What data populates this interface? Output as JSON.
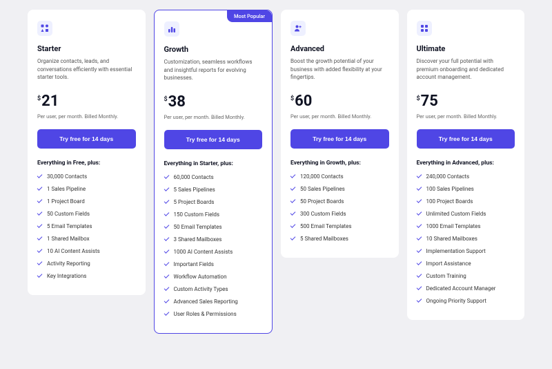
{
  "plans": [
    {
      "name": "Starter",
      "description": "Organize contacts, leads, and conversations efficiently with essential starter tools.",
      "currency": "$",
      "price": "21",
      "billing": "Per user, per month. Billed Monthly.",
      "cta": "Try free for 14 days",
      "features_heading": "Everything in Free, plus:",
      "features": [
        "30,000 Contacts",
        "1 Sales Pipeline",
        "1 Project Board",
        "50 Custom Fields",
        "5 Email Templates",
        "1 Shared Mailbox",
        "10 AI Content Assists",
        "Activity Reporting",
        "Key Integrations"
      ],
      "featured": false
    },
    {
      "name": "Growth",
      "badge": "Most Popular",
      "description": "Customization, seamless workflows and insightful reports for evolving businesses.",
      "currency": "$",
      "price": "38",
      "billing": "Per user, per month. Billed Monthly.",
      "cta": "Try free for 14 days",
      "features_heading": "Everything in Starter, plus:",
      "features": [
        "60,000 Contacts",
        "5 Sales Pipelines",
        "5 Project Boards",
        "150 Custom Fields",
        "50 Email Templates",
        "3 Shared Mailboxes",
        "1000 AI Content Assists",
        "Important Fields",
        "Workflow Automation",
        "Custom Activity Types",
        "Advanced Sales Reporting",
        "User Roles & Permissions"
      ],
      "featured": true
    },
    {
      "name": "Advanced",
      "description": "Boost the growth potential of your business with added flexibility at your fingertips.",
      "currency": "$",
      "price": "60",
      "billing": "Per user, per month. Billed Monthly.",
      "cta": "Try free for 14 days",
      "features_heading": "Everything in Growth, plus:",
      "features": [
        "120,000 Contacts",
        "50 Sales Pipelines",
        "50 Project Boards",
        "300 Custom Fields",
        "500 Email Templates",
        "5 Shared Mailboxes"
      ],
      "featured": false
    },
    {
      "name": "Ultimate",
      "description": "Discover your full potential with premium onboarding and dedicated account management.",
      "currency": "$",
      "price": "75",
      "billing": "Per user, per month. Billed Monthly.",
      "cta": "Try free for 14 days",
      "features_heading": "Everything in Advanced, plus:",
      "features": [
        "240,000 Contacts",
        "100 Sales Pipelines",
        "100 Project Boards",
        "Unlimited Custom Fields",
        "1000 Email Templates",
        "10 Shared Mailboxes",
        "Implementation Support",
        "Import Assistance",
        "Custom Training",
        "Dedicated Account Manager",
        "Ongoing Priority Support"
      ],
      "featured": false
    }
  ]
}
